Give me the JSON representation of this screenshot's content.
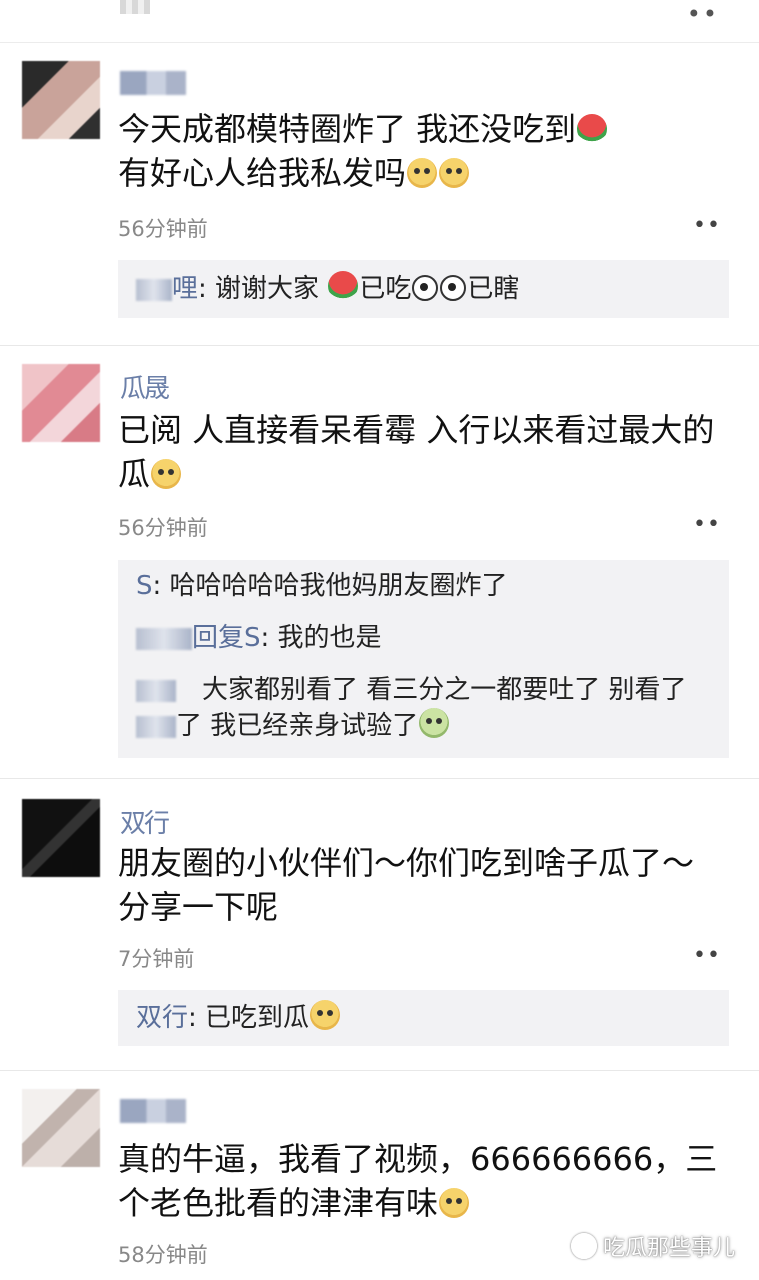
{
  "posts": [
    {
      "text_line1": "今天成都模特圈炸了 我还没吃到",
      "text_line2": "有好心人给我私发吗",
      "time": "56分钟前",
      "replies": [
        {
          "name": "哩",
          "text": ": 谢谢大家 ",
          "suffix1": "已吃",
          "suffix2": "已瞎"
        }
      ]
    },
    {
      "name": "瓜晟",
      "text_line1": "已阅 人直接看呆看霉 入行以来看过最大的",
      "text_line2": "瓜",
      "time": "56分钟前",
      "replies": [
        {
          "name": "S",
          "text": ": 哈哈哈哈哈我他妈朋友圈炸了"
        },
        {
          "name": "回复S",
          "text": ": 我的也是"
        },
        {
          "text_line1": "大家都别看了 看三分之一都要吐了 别看了",
          "text_line2": "了 我已经亲身试验了"
        }
      ]
    },
    {
      "name": "双行",
      "text_line1": "朋友圈的小伙伴们～你们吃到啥子瓜了～",
      "text_line2": "分享一下呢",
      "time": "7分钟前",
      "replies": [
        {
          "name": "双行",
          "text": ": 已吃到瓜"
        }
      ]
    },
    {
      "text_line1": "真的牛逼，我看了视频，666666666，三",
      "text_line2": "个老色批看的津津有味",
      "time": "58分钟前"
    }
  ],
  "more_icon": "••",
  "watermark": "吃瓜那些事儿",
  "icons": [
    "more-dots-icon",
    "watermelon-emoji-icon",
    "face-emoji-icon",
    "eye-emoji-icon"
  ]
}
